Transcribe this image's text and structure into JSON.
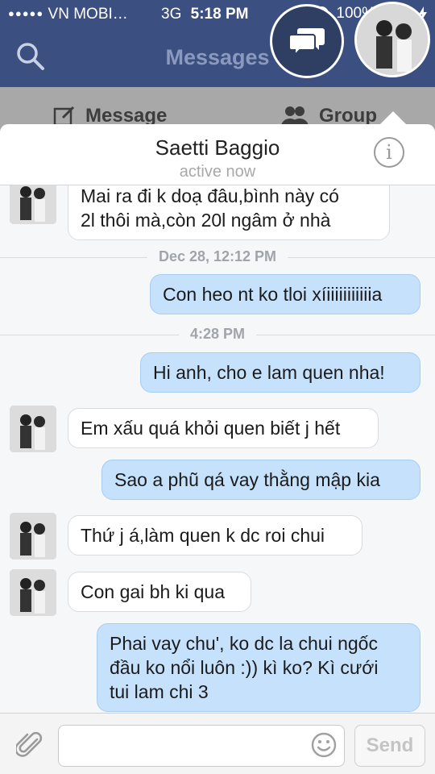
{
  "status_bar": {
    "signal_dots": "●●●●●",
    "carrier": "VN MOBI…",
    "network": "3G",
    "time": "5:18 PM",
    "battery": "100%"
  },
  "nav": {
    "title": "Messages",
    "search_icon": "search-icon",
    "chat_heads_icon": "chat-bubbles-icon"
  },
  "subbar": {
    "message_label": "Message",
    "group_label": "Group"
  },
  "conversation": {
    "name": "Saetti Baggio",
    "status": "active now",
    "info_glyph": "i"
  },
  "thread": {
    "messages": [
      {
        "dir": "in",
        "lines": [
          "Mai ra đi k doạ đâu,bình này có",
          "2l thôi mà,còn 20l ngâm ở nhà"
        ]
      },
      {
        "timestamp": "Dec 28, 12:12 PM"
      },
      {
        "dir": "out",
        "lines": [
          "Con heo nt ko tloi xíiiiiiiiiiiia"
        ]
      },
      {
        "timestamp": "4:28 PM"
      },
      {
        "dir": "out",
        "lines": [
          "Hi anh, cho e lam quen nha!"
        ]
      },
      {
        "dir": "in",
        "lines": [
          "Em xấu quá khỏi quen biết j hết"
        ]
      },
      {
        "dir": "out",
        "lines": [
          "Sao a phũ qá vay thằng mập kia"
        ]
      },
      {
        "dir": "in",
        "lines": [
          "Thứ j á,làm quen k dc roi chui"
        ]
      },
      {
        "dir": "in",
        "lines": [
          "Con gai bh ki qua"
        ]
      },
      {
        "dir": "out",
        "lines": [
          "Phai vay chu', ko dc la chui ngốc",
          "đầu ko nổi luôn :)) kì ko? Kì cưới",
          "tui lam chi 3"
        ]
      }
    ]
  },
  "composer": {
    "send_label": "Send",
    "attach_icon": "paperclip-icon",
    "emoji_icon": "smiley-icon"
  }
}
